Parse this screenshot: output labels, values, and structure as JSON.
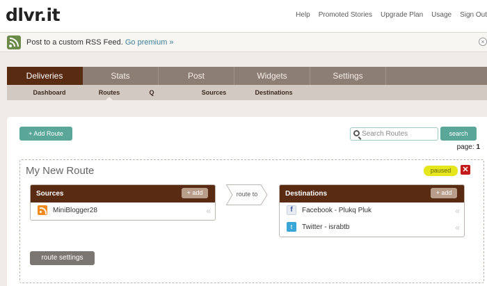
{
  "app": {
    "logo": "dlvr.it"
  },
  "topnav": [
    "Help",
    "Promoted Stories",
    "Upgrade Plan",
    "Usage",
    "Sign Out"
  ],
  "promo": {
    "text": "Post to a custom RSS Feed.",
    "link": "Go premium »"
  },
  "main_tabs": [
    {
      "label": "Deliveries",
      "active": true
    },
    {
      "label": "Stats",
      "active": false
    },
    {
      "label": "Post",
      "active": false
    },
    {
      "label": "Widgets",
      "active": false
    },
    {
      "label": "Settings",
      "active": false
    }
  ],
  "sub_tabs": [
    {
      "label": "Dashboard",
      "active": false
    },
    {
      "label": "Routes",
      "active": true
    },
    {
      "label": "Q",
      "active": false
    },
    {
      "label": "Sources",
      "active": false
    },
    {
      "label": "Destinations",
      "active": false
    }
  ],
  "toolbar": {
    "add_route": "+ Add Route",
    "search_placeholder": "Search Routes",
    "search_button": "search",
    "page_label": "page:",
    "page_number": "1"
  },
  "route": {
    "title": "My New Route",
    "status": "paused",
    "delete": "✕",
    "route_to": "route to",
    "settings_button": "route settings",
    "sources": {
      "title": "Sources",
      "add": "+ add",
      "items": [
        {
          "label": "MiniBlogger28",
          "icon": "rss-icon"
        }
      ]
    },
    "destinations": {
      "title": "Destinations",
      "add": "+ add",
      "items": [
        {
          "label": "Facebook - Plukq Pluk",
          "icon": "facebook-icon"
        },
        {
          "label": "Twitter - israbtb",
          "icon": "twitter-icon"
        }
      ]
    }
  },
  "colors": {
    "brand_brown": "#5a2b13",
    "teal": "#5aa79a",
    "paused_yellow": "#e6e61c",
    "delete_red": "#c31a1a"
  }
}
